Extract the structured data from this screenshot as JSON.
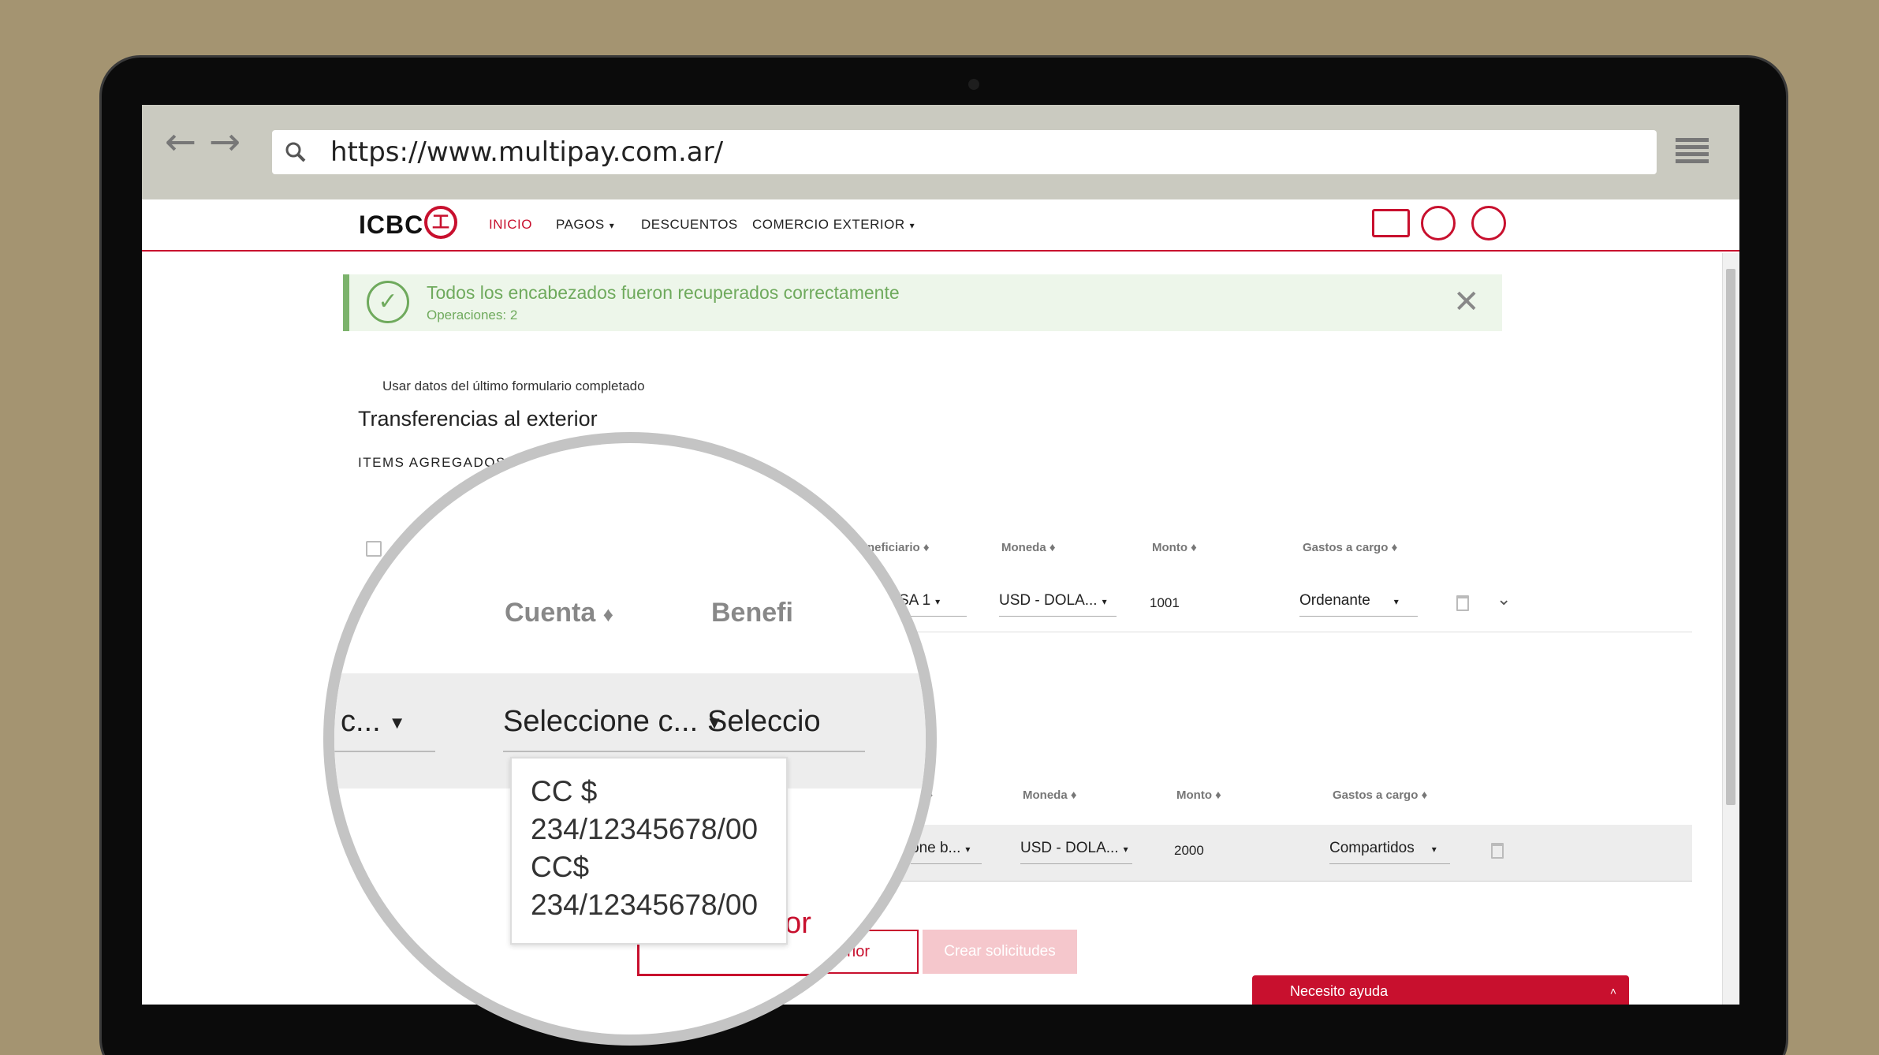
{
  "browser": {
    "url": "https://www.multipay.com.ar/",
    "back_icon": "←",
    "forward_icon": "→"
  },
  "nav": {
    "logo": "ICBC",
    "logo_mark": "工",
    "items": [
      {
        "label": "INICIO",
        "active": true,
        "caret": false
      },
      {
        "label": "PAGOS",
        "active": false,
        "caret": true
      },
      {
        "label": "DESCUENTOS",
        "active": false,
        "caret": false
      },
      {
        "label": "COMERCIO EXTERIOR",
        "active": false,
        "caret": true
      }
    ],
    "caret": "▾"
  },
  "alert": {
    "title": "Todos los encabezados fueron recuperados correctamente",
    "subtitle": "Operaciones: 2",
    "check_icon": "✓",
    "close_icon": "✕"
  },
  "form": {
    "use_last_label": "Usar datos del último formulario completado",
    "title": "Transferencias al exterior",
    "items_label": "ITEMS AGREGADOS"
  },
  "table1": {
    "headers": {
      "beneficiario": "neficiario",
      "moneda": "Moneda",
      "monto": "Monto",
      "gastos": "Gastos a cargo"
    },
    "sort_icon": "♦",
    "row": {
      "beneficiario": "SA 1",
      "moneda": "USD - DOLA...",
      "monto": "1001",
      "gastos": "Ordenante"
    }
  },
  "table2": {
    "headers": {
      "beneficiario": "io",
      "moneda": "Moneda",
      "monto": "Monto",
      "gastos": "Gastos a cargo"
    },
    "row": {
      "beneficiario": "one b...",
      "moneda": "USD - DOLA...",
      "monto": "2000",
      "gastos": "Compartidos"
    }
  },
  "buttons": {
    "outline_label": "rior",
    "primary_label": "Crear solicitudes"
  },
  "help": {
    "label": "Necesito ayuda",
    "chevron": "˄"
  },
  "magnifier": {
    "header_cuenta": "Cuenta",
    "header_benef": "Benefi",
    "sort_icon": "♦",
    "cell_left": "c...",
    "cell_cuenta": "Seleccione c...",
    "cell_benef": "Seleccio",
    "caret": "▼",
    "dropdown_options": [
      "CC $ 234/12345678/00",
      "CC$ 234/12345678/00"
    ],
    "red_text": "rior"
  }
}
